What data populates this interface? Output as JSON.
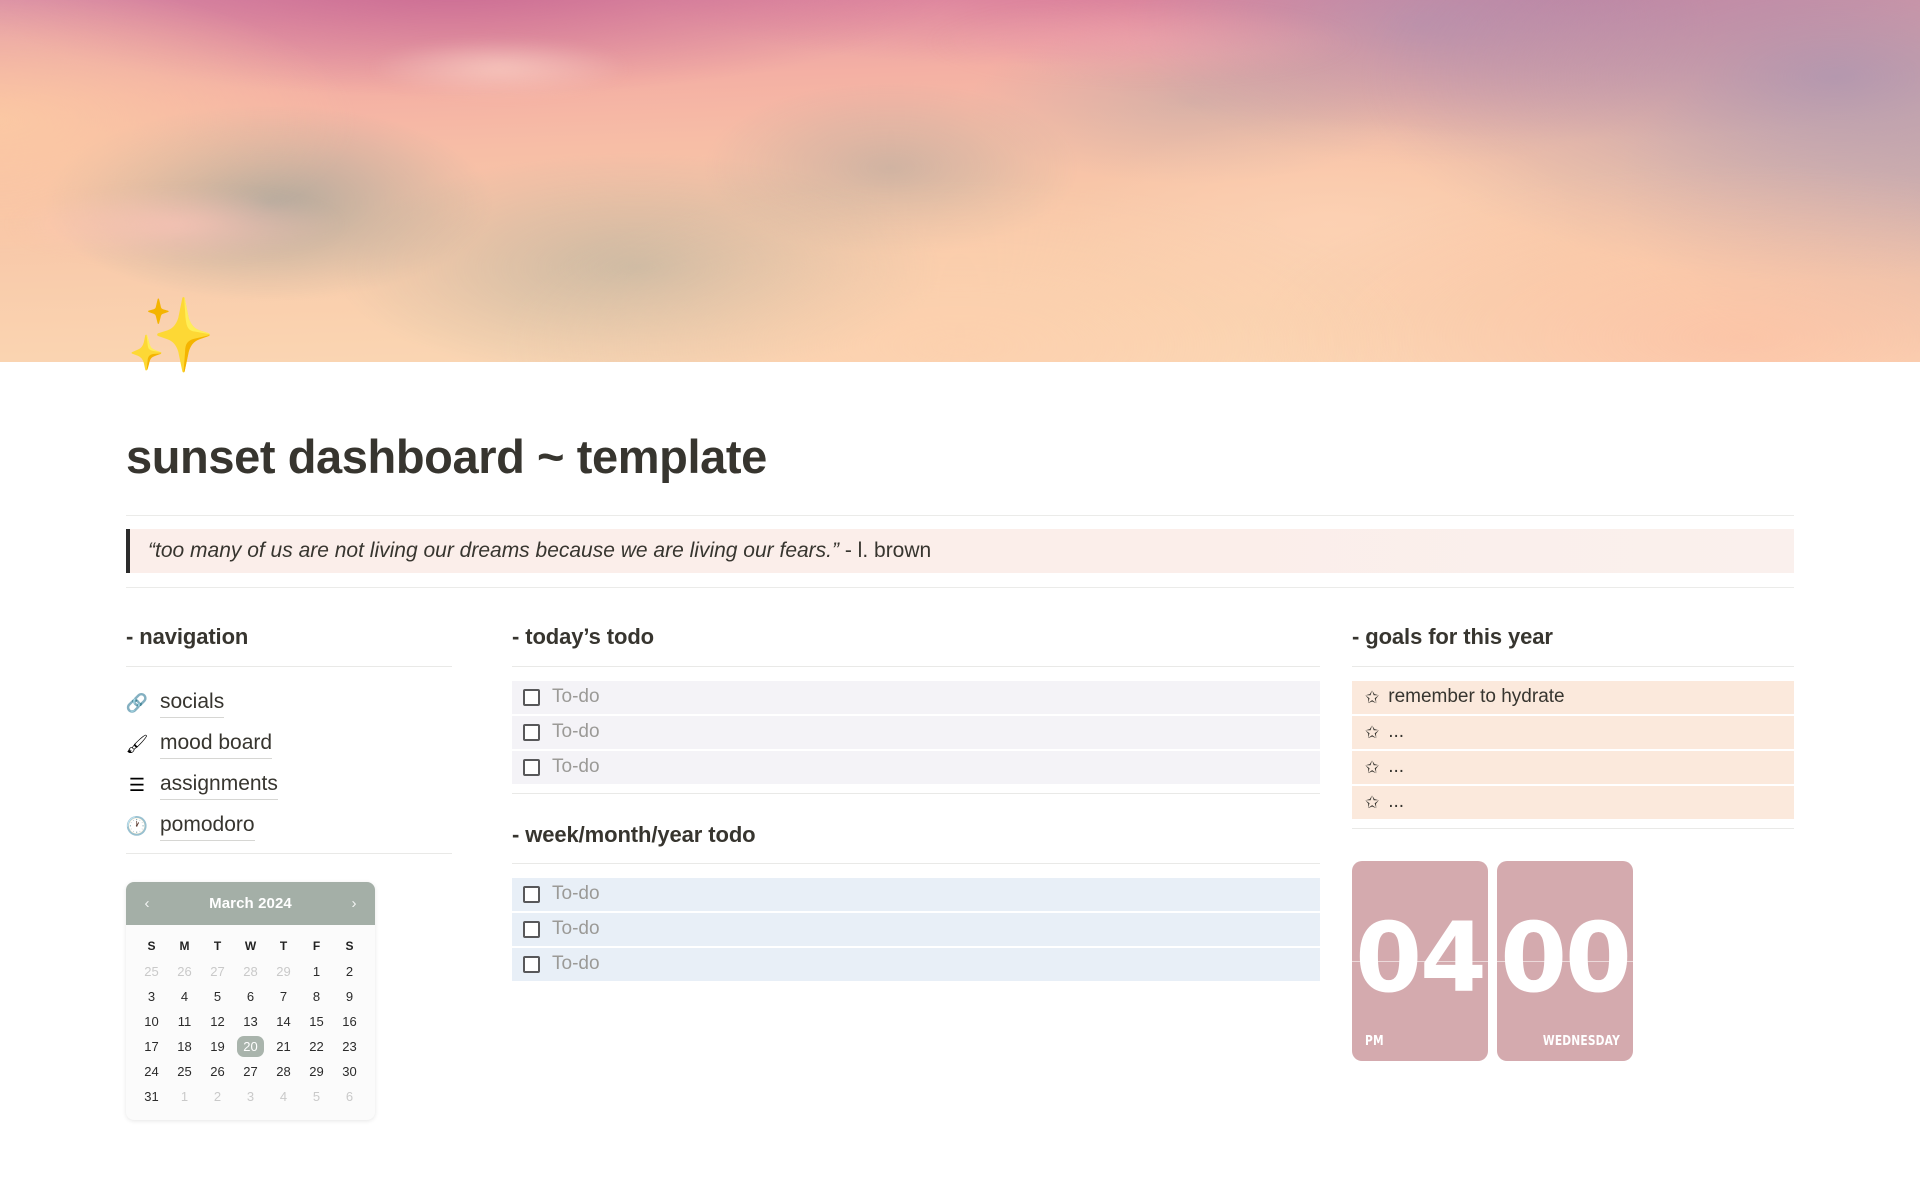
{
  "cover": {
    "alt": "sunset sky with pink and peach clouds"
  },
  "header": {
    "emoji": "✨",
    "title": "sunset dashboard ~ template"
  },
  "quote": {
    "text": "“too many of us are not living our dreams because we are living our fears.”",
    "author": " - l. brown"
  },
  "navigation": {
    "heading": "- navigation",
    "items": [
      {
        "icon": "🔗",
        "icon_name": "link-icon",
        "label": "socials"
      },
      {
        "icon": "🖌",
        "icon_name": "paintbrush-icon",
        "label": "mood board"
      },
      {
        "icon": "☰",
        "icon_name": "list-icon",
        "label": "assignments"
      },
      {
        "icon": "🕐",
        "icon_name": "clock-icon",
        "label": "pomodoro"
      }
    ]
  },
  "calendar": {
    "month_label": "March 2024",
    "prev_icon": "‹",
    "next_icon": "›",
    "day_initials": [
      "S",
      "M",
      "T",
      "W",
      "T",
      "F",
      "S"
    ],
    "today": 20,
    "weeks": [
      [
        {
          "n": "25",
          "muted": true
        },
        {
          "n": "26",
          "muted": true
        },
        {
          "n": "27",
          "muted": true
        },
        {
          "n": "28",
          "muted": true
        },
        {
          "n": "29",
          "muted": true
        },
        {
          "n": "1",
          "muted": false
        },
        {
          "n": "2",
          "muted": false
        }
      ],
      [
        {
          "n": "3",
          "muted": false
        },
        {
          "n": "4",
          "muted": false
        },
        {
          "n": "5",
          "muted": false
        },
        {
          "n": "6",
          "muted": false
        },
        {
          "n": "7",
          "muted": false
        },
        {
          "n": "8",
          "muted": false
        },
        {
          "n": "9",
          "muted": false
        }
      ],
      [
        {
          "n": "10",
          "muted": false
        },
        {
          "n": "11",
          "muted": false
        },
        {
          "n": "12",
          "muted": false
        },
        {
          "n": "13",
          "muted": false
        },
        {
          "n": "14",
          "muted": false
        },
        {
          "n": "15",
          "muted": false
        },
        {
          "n": "16",
          "muted": false
        }
      ],
      [
        {
          "n": "17",
          "muted": false
        },
        {
          "n": "18",
          "muted": false
        },
        {
          "n": "19",
          "muted": false
        },
        {
          "n": "20",
          "muted": false,
          "today": true
        },
        {
          "n": "21",
          "muted": false
        },
        {
          "n": "22",
          "muted": false
        },
        {
          "n": "23",
          "muted": false
        }
      ],
      [
        {
          "n": "24",
          "muted": false
        },
        {
          "n": "25",
          "muted": false
        },
        {
          "n": "26",
          "muted": false
        },
        {
          "n": "27",
          "muted": false
        },
        {
          "n": "28",
          "muted": false
        },
        {
          "n": "29",
          "muted": false
        },
        {
          "n": "30",
          "muted": false
        }
      ],
      [
        {
          "n": "31",
          "muted": false
        },
        {
          "n": "1",
          "muted": true
        },
        {
          "n": "2",
          "muted": true
        },
        {
          "n": "3",
          "muted": true
        },
        {
          "n": "4",
          "muted": true
        },
        {
          "n": "5",
          "muted": true
        },
        {
          "n": "6",
          "muted": true
        }
      ]
    ]
  },
  "today_todo": {
    "heading": "- today’s todo",
    "items": [
      "To-do",
      "To-do",
      "To-do"
    ]
  },
  "period_todo": {
    "heading": "- week/month/year todo",
    "items": [
      "To-do",
      "To-do",
      "To-do"
    ]
  },
  "goals": {
    "heading": "- goals for this year",
    "icon": "✩",
    "items": [
      "remember to hydrate",
      "...",
      "...",
      "..."
    ]
  },
  "clock": {
    "hours": "04",
    "minutes": "00",
    "meridiem": "PM",
    "weekday": "WEDNESDAY"
  },
  "colors": {
    "accent_rose": "#d4aaae",
    "calendar_header": "#a4afa7",
    "goal_row": "#fbe9dc",
    "todo_grey": "#f4f3f7",
    "todo_blue": "#e8eff7",
    "quote_bg": "#fbeeea",
    "text": "#37352f",
    "muted_text": "#9b9a97"
  }
}
